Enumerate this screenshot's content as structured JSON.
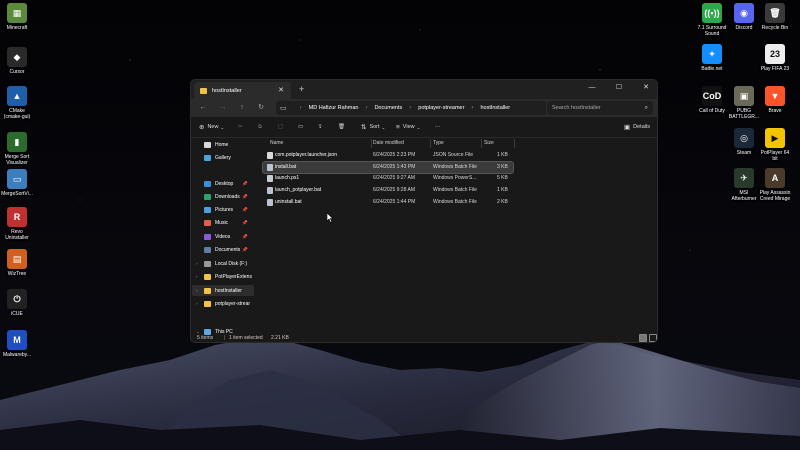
{
  "colors": {
    "accent": "#4cc2ff",
    "folder": "#f4c246",
    "window_bg": "#191919",
    "selection": "#3b3b3b"
  },
  "desktop": {
    "left_icons": [
      {
        "label": "Minecraft",
        "icon": "minecraft-icon",
        "glyph": "▦",
        "color": "#5b8a3a"
      },
      {
        "label": "Cursor",
        "icon": "cursor-app-icon",
        "glyph": "◆",
        "color": "#2a2a2a"
      },
      {
        "label": "CMake (cmake-gui)",
        "icon": "cmake-icon",
        "glyph": "▲",
        "color": "#1f5faa"
      },
      {
        "label": "Merge Sort Visualizer",
        "icon": "merge-sort-visualizer-icon",
        "glyph": "▮",
        "color": "#2d6a2d"
      },
      {
        "label": "MergeSortVi...",
        "icon": "merge-sort-shortcut-icon",
        "glyph": "▭",
        "color": "#3b7fbf"
      },
      {
        "label": "Revo Uninstaller",
        "icon": "revo-uninstaller-icon",
        "glyph": "R",
        "color": "#c03030"
      },
      {
        "label": "WizTree",
        "icon": "wiztree-icon",
        "glyph": "▤",
        "color": "#d06020"
      },
      {
        "label": "iCUE",
        "icon": "icue-icon",
        "glyph": "⏻",
        "color": "#222222"
      },
      {
        "label": "Malwareby...",
        "icon": "malwarebytes-icon",
        "glyph": "M",
        "color": "#1f4fbf"
      }
    ],
    "right_icons": [
      {
        "label": "7.1 Surround Sound",
        "icon": "surround-sound-icon",
        "glyph": "((•))",
        "color": "#2aa84a"
      },
      {
        "label": "Discord",
        "icon": "discord-icon",
        "glyph": "◉",
        "color": "#5865f2"
      },
      {
        "label": "Recycle Bin",
        "icon": "recycle-bin-icon",
        "glyph": "🗑",
        "color": "#3a3a3a"
      },
      {
        "label": "Battle.net",
        "icon": "battlenet-icon",
        "glyph": "✦",
        "color": "#148eff"
      },
      {
        "label": "Play FIFA 23",
        "icon": "fifa-23-icon",
        "glyph": "23",
        "color": "#eeeeee"
      },
      {
        "label": "Call of Duty",
        "icon": "call-of-duty-icon",
        "glyph": "CoD",
        "color": "#111111"
      },
      {
        "label": "PUBG BATTLEGR...",
        "icon": "pubg-icon",
        "glyph": "▣",
        "color": "#6a6a58"
      },
      {
        "label": "Brave",
        "icon": "brave-icon",
        "glyph": "▼",
        "color": "#fb542b"
      },
      {
        "label": "Steam",
        "icon": "steam-icon",
        "glyph": "◎",
        "color": "#1b2838"
      },
      {
        "label": "PotPlayer 64 bit",
        "icon": "potplayer-icon",
        "glyph": "▶",
        "color": "#f5c400"
      },
      {
        "label": "MSI Afterburner",
        "icon": "msi-afterburner-icon",
        "glyph": "✈",
        "color": "#2a3a2a"
      },
      {
        "label": "Play Assassin Creed Mirage",
        "icon": "assassins-creed-icon",
        "glyph": "A",
        "color": "#4a3a2a"
      }
    ]
  },
  "window": {
    "tab_title": "hostInstaller",
    "new_tab": "+",
    "controls": {
      "minimize": "—",
      "maximize": "☐",
      "close": "✕"
    },
    "breadcrumbs": [
      "MD Hafizur Rahman",
      "Documents",
      "potplayer-streamer",
      "hostInstaller"
    ],
    "search_placeholder": "Search hostInstaller",
    "toolbar": {
      "new": "New",
      "sort": "Sort",
      "view": "View",
      "more": "···",
      "details": "Details"
    },
    "sidebar": [
      {
        "label": "Home",
        "icon": "home-icon",
        "color": "#d9d9d9",
        "pinned": false
      },
      {
        "label": "Gallery",
        "icon": "gallery-icon",
        "color": "#4aa3df",
        "pinned": false
      },
      {
        "label": "Desktop",
        "icon": "desktop-folder-icon",
        "color": "#3c8fd6",
        "pinned": true
      },
      {
        "label": "Downloads",
        "icon": "downloads-folder-icon",
        "color": "#29a36a",
        "pinned": true
      },
      {
        "label": "Pictures",
        "icon": "pictures-folder-icon",
        "color": "#4a9fe0",
        "pinned": true
      },
      {
        "label": "Music",
        "icon": "music-folder-icon",
        "color": "#e0604a",
        "pinned": true
      },
      {
        "label": "Videos",
        "icon": "videos-folder-icon",
        "color": "#8a5bd6",
        "pinned": true
      },
      {
        "label": "Documents",
        "icon": "documents-folder-icon",
        "color": "#5f7fa0",
        "pinned": true
      },
      {
        "label": "Local Disk (F:)",
        "icon": "drive-icon",
        "color": "#9a9a9a",
        "pinned": false
      },
      {
        "label": "PotPlayerExtens",
        "icon": "folder-icon",
        "color": "#f4c246",
        "pinned": false
      },
      {
        "label": "hostInstaller",
        "icon": "folder-icon",
        "color": "#f4c246",
        "pinned": false,
        "selected": true
      },
      {
        "label": "potplayer-strear",
        "icon": "folder-icon",
        "color": "#f4c246",
        "pinned": false
      }
    ],
    "this_pc": "This PC",
    "columns": [
      "Name",
      "Date modified",
      "Type",
      "Size"
    ],
    "files": [
      {
        "name": "com.potplayer.launcher.json",
        "date": "6/24/2025 2:23 PM",
        "type": "JSON Source File",
        "size": "1 KB",
        "icon": "json-file-icon",
        "selected": false
      },
      {
        "name": "install.bat",
        "date": "6/24/2025 1:43 PM",
        "type": "Windows Batch File",
        "size": "3 KB",
        "icon": "bat-file-icon",
        "selected": true
      },
      {
        "name": "launch.ps1",
        "date": "6/24/2025 9:27 AM",
        "type": "Windows PowerS...",
        "size": "5 KB",
        "icon": "powershell-file-icon",
        "selected": false
      },
      {
        "name": "launch_potplayer.bat",
        "date": "6/24/2025 9:28 AM",
        "type": "Windows Batch File",
        "size": "1 KB",
        "icon": "bat-file-icon",
        "selected": false
      },
      {
        "name": "uninstall.bat",
        "date": "6/24/2025 1:44 PM",
        "type": "Windows Batch File",
        "size": "2 KB",
        "icon": "bat-file-icon",
        "selected": false
      }
    ],
    "status": {
      "items": "5 items",
      "selected": "1 item selected",
      "size": "2.21 KB"
    }
  }
}
